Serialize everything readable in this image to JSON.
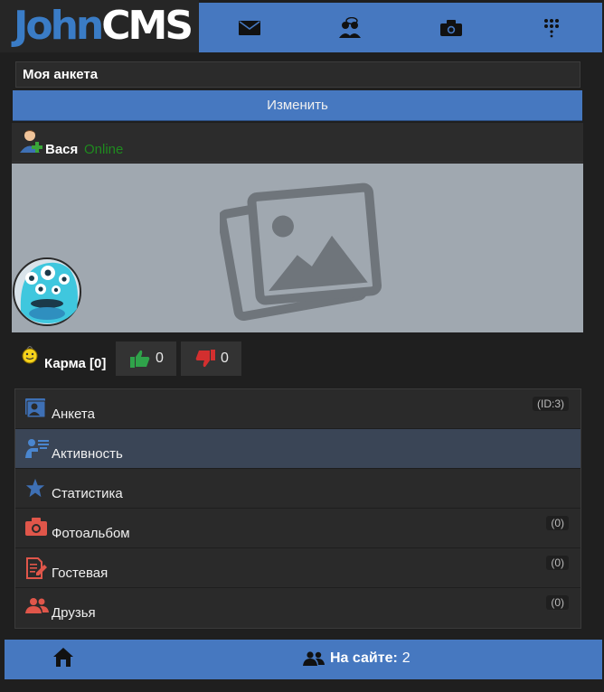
{
  "header": {
    "logo_part1": "John",
    "logo_part2": "CMS",
    "nav": [
      {
        "icon": "envelope-icon"
      },
      {
        "icon": "users-chat-icon"
      },
      {
        "icon": "camera-icon"
      },
      {
        "icon": "menu-dots-icon"
      }
    ]
  },
  "page": {
    "title": "Моя анкета",
    "edit_label": "Изменить"
  },
  "user": {
    "name": "Вася",
    "status": "Online"
  },
  "karma": {
    "label": "Карма [0]",
    "up_count": "0",
    "down_count": "0"
  },
  "menu": [
    {
      "label": "Анкета",
      "badge": "(ID:3)",
      "icon": "profile-card-icon"
    },
    {
      "label": "Активность",
      "badge": "",
      "icon": "activity-icon"
    },
    {
      "label": "Статистика",
      "badge": "",
      "icon": "star-icon"
    },
    {
      "label": "Фотоальбом",
      "badge": "(0)",
      "icon": "camera-icon"
    },
    {
      "label": "Гостевая",
      "badge": "(0)",
      "icon": "guestbook-icon"
    },
    {
      "label": "Друзья",
      "badge": "(0)",
      "icon": "friends-icon"
    }
  ],
  "footer": {
    "online_label": "На сайте:",
    "online_count": "2"
  },
  "colors": {
    "accent": "#4678c0",
    "background": "#1f1f1f",
    "online_status": "#1f8a1f",
    "icon_blue": "#3e70b5",
    "icon_red": "#e0564a"
  }
}
